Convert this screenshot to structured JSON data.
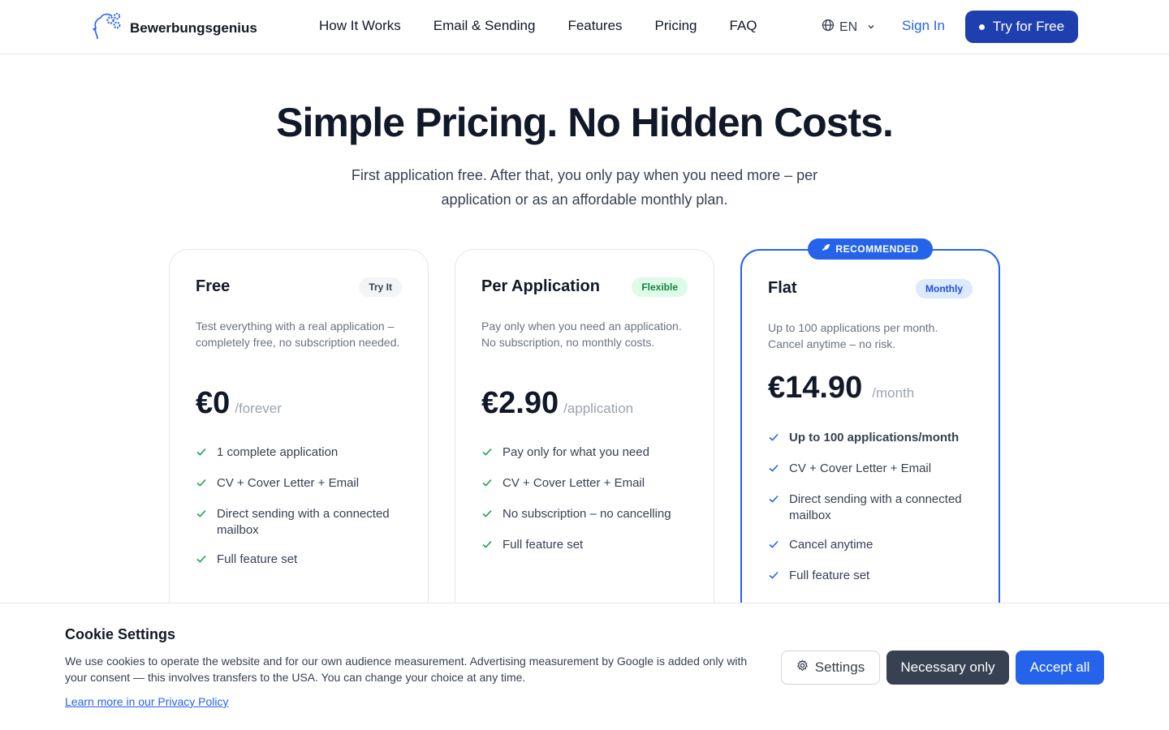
{
  "brand": {
    "name": "Bewerbungsgenius"
  },
  "nav": {
    "items": [
      "How It Works",
      "Email & Sending",
      "Features",
      "Pricing",
      "FAQ"
    ]
  },
  "header": {
    "language": "EN",
    "sign_in": "Sign In",
    "cta": "Try for Free"
  },
  "hero": {
    "title": "Simple Pricing. No Hidden Costs.",
    "subtitle": "First application free. After that, you only pay when you need more – per application or as an affordable monthly plan."
  },
  "plans": [
    {
      "name": "Free",
      "tag": "Try It",
      "description": "Test everything with a real application – completely free, no subscription needed.",
      "price": "€0",
      "unit": "/forever",
      "features": [
        "1 complete application",
        "CV + Cover Letter + Email",
        "Direct sending with a connected mailbox",
        "Full feature set"
      ]
    },
    {
      "name": "Per Application",
      "tag": "Flexible",
      "description": "Pay only when you need an application. No subscription, no monthly costs.",
      "price": "€2.90",
      "unit": "/application",
      "features": [
        "Pay only for what you need",
        "CV + Cover Letter + Email",
        "No subscription – no cancelling",
        "Full feature set"
      ]
    },
    {
      "name": "Flat",
      "tag": "Monthly",
      "badge": "RECOMMENDED",
      "description": "Up to 100 applications per month. Cancel anytime – no risk.",
      "price": "€14.90",
      "unit": "/month",
      "features": [
        "Up to 100 applications/month",
        "CV + Cover Letter + Email",
        "Direct sending with a connected mailbox",
        "Cancel anytime",
        "Full feature set"
      ]
    }
  ],
  "cookie": {
    "title": "Cookie Settings",
    "text": "We use cookies to operate the website and for our own audience measurement. Advertising measurement by Google is added only with your consent — this involves transfers to the USA. You can change your choice at any time.",
    "link": "Learn more in our Privacy Policy",
    "settings": "Settings",
    "necessary": "Necessary only",
    "accept": "Accept all"
  },
  "colors": {
    "primary": "#2563eb",
    "dark_cta": "#1e40af",
    "success": "#16a34a",
    "text": "#111827"
  },
  "icons": [
    "brain-gear-logo-icon",
    "globe-icon",
    "chevron-down-icon",
    "check-icon",
    "rocket-icon",
    "gear-icon"
  ]
}
